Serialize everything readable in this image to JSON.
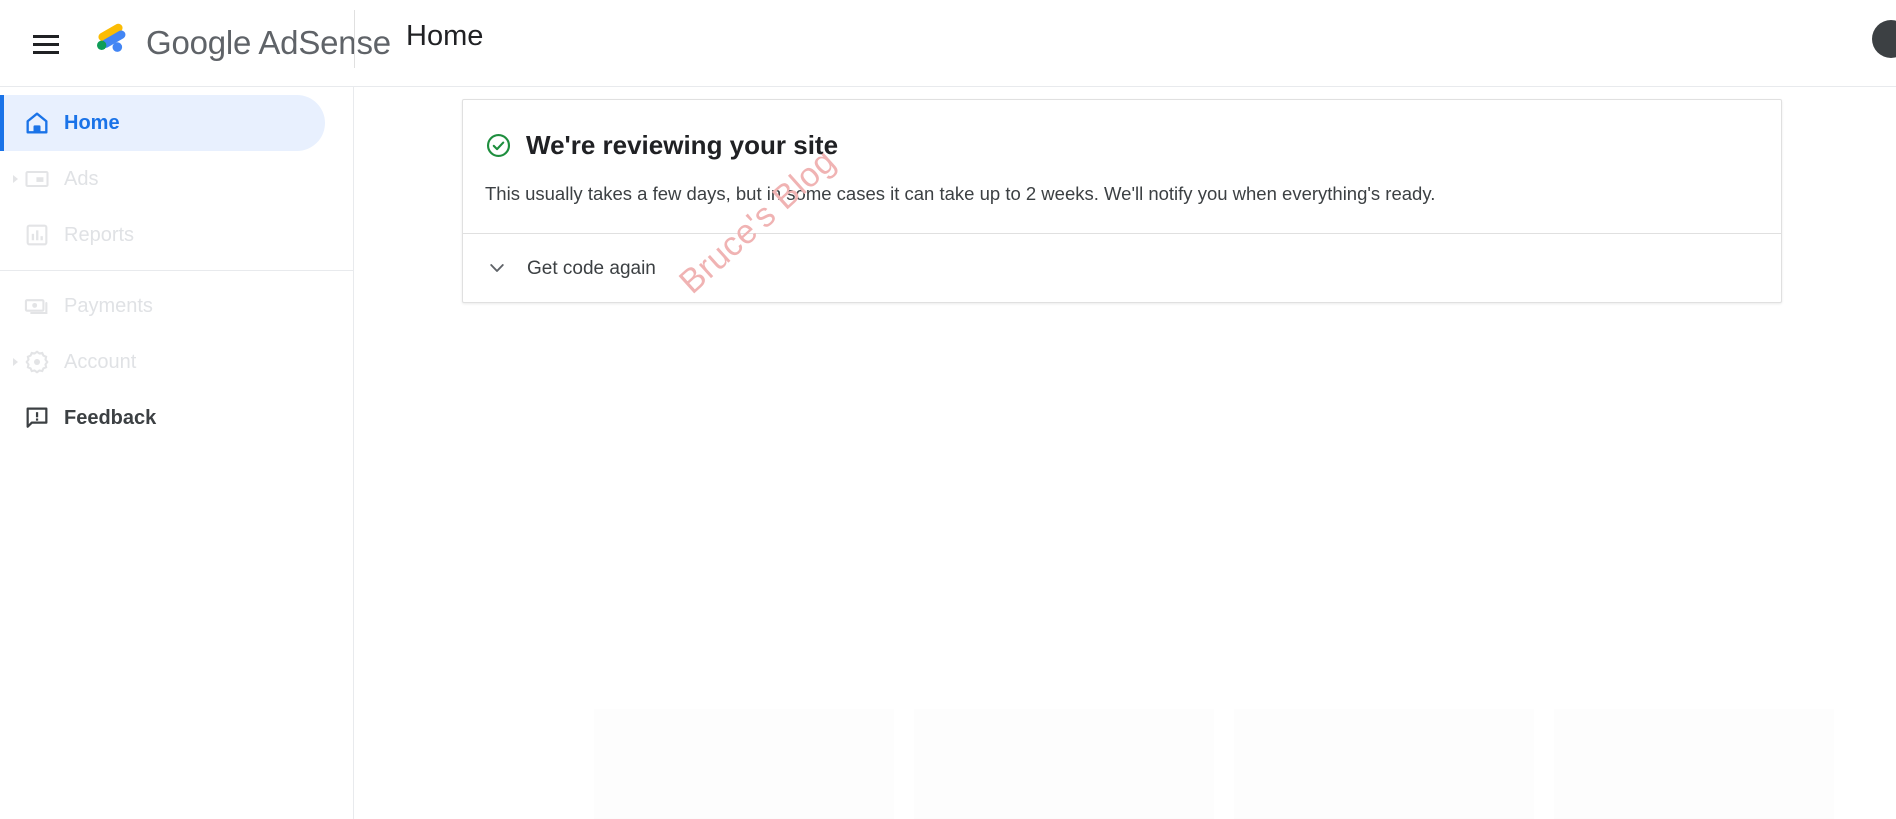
{
  "app": {
    "brand_name": "Google AdSense",
    "menu_icon": "hamburger-menu-icon",
    "logo_icon": "adsense-logo-icon"
  },
  "header": {
    "title": "Home",
    "avatar_icon": "user-avatar"
  },
  "sidebar": {
    "items": [
      {
        "label": "Home",
        "icon": "home-icon",
        "state": "active",
        "expandable": false
      },
      {
        "label": "Ads",
        "icon": "ads-icon",
        "state": "dim",
        "expandable": true
      },
      {
        "label": "Reports",
        "icon": "reports-icon",
        "state": "dim",
        "expandable": false
      },
      {
        "label": "Payments",
        "icon": "payments-icon",
        "state": "dim",
        "expandable": false
      },
      {
        "label": "Account",
        "icon": "account-icon",
        "state": "dim",
        "expandable": true
      },
      {
        "label": "Feedback",
        "icon": "feedback-icon",
        "state": "plain",
        "expandable": false
      }
    ]
  },
  "main": {
    "card": {
      "status_icon": "check-circle-icon",
      "heading": "We're reviewing your site",
      "body": "This usually takes a few days, but in some cases it can take up to 2 weeks. We'll notify you when everything's ready.",
      "footer_icon": "chevron-down-icon",
      "footer_label": "Get code again"
    }
  },
  "watermark": {
    "text": "Bruce's Blog"
  },
  "colors": {
    "accent_blue": "#1a73e8",
    "active_bg": "#e8f0fe",
    "success_green": "#1e8e3e",
    "text_primary": "#202124",
    "text_secondary": "#3c4043",
    "text_disabled": "#e0e2e5",
    "border": "#e0e0e0",
    "watermark": "#f0b3b3"
  }
}
